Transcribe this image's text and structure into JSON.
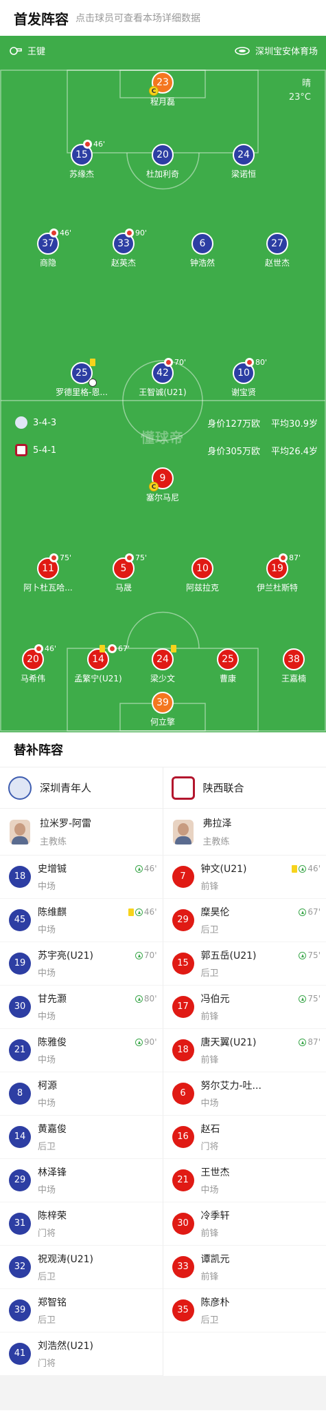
{
  "header": {
    "title": "首发阵容",
    "subtitle": "点击球员可查看本场详细数据"
  },
  "pitch": {
    "referee": "王键",
    "venue": "深圳宝安体育场",
    "weather": {
      "condition": "晴",
      "temperature": "23°C"
    },
    "watermark": "懂球帝"
  },
  "home_team": {
    "name": "深圳青年人",
    "formation": "3-4-3",
    "value": "身价127万欧",
    "avg_age": "平均30.9岁",
    "color": "#2d3ea3",
    "lineup": [
      {
        "number": "23",
        "name": "程月磊",
        "captain_mark": "C"
      },
      {
        "number": "15",
        "name": "苏缘杰",
        "sub_minute": "46'"
      },
      {
        "number": "20",
        "name": "杜加利奇"
      },
      {
        "number": "24",
        "name": "梁诺恒"
      },
      {
        "number": "37",
        "name": "商隐",
        "sub_minute": "46'"
      },
      {
        "number": "33",
        "name": "赵英杰",
        "sub_minute": "90'"
      },
      {
        "number": "6",
        "name": "钟浩然"
      },
      {
        "number": "27",
        "name": "赵世杰"
      },
      {
        "number": "25",
        "name": "罗德里格-恩..."
      },
      {
        "number": "42",
        "name": "王智诚(U21)",
        "sub_minute": "70'"
      },
      {
        "number": "10",
        "name": "谢宝贤",
        "sub_minute": "80'"
      }
    ]
  },
  "away_team": {
    "name": "陕西联合",
    "formation": "5-4-1",
    "value": "身价305万欧",
    "avg_age": "平均26.4岁",
    "color": "#e01a14",
    "lineup": [
      {
        "number": "9",
        "name": "塞尔马尼",
        "captain_mark": "C"
      },
      {
        "number": "11",
        "name": "阿卜杜瓦哈...",
        "sub_minute": "75'"
      },
      {
        "number": "5",
        "name": "马晟",
        "sub_minute": "75'"
      },
      {
        "number": "10",
        "name": "阿兹拉克"
      },
      {
        "number": "19",
        "name": "伊兰杜斯特",
        "sub_minute": "87'"
      },
      {
        "number": "20",
        "name": "马希伟",
        "sub_minute": "46'"
      },
      {
        "number": "14",
        "name": "孟繁宁(U21)",
        "sub_minute": "67'"
      },
      {
        "number": "24",
        "name": "梁少文"
      },
      {
        "number": "25",
        "name": "曹康"
      },
      {
        "number": "38",
        "name": "王嘉楠"
      },
      {
        "number": "39",
        "name": "何立擎"
      }
    ]
  },
  "substitutes": {
    "title": "替补阵容",
    "home": {
      "coach": {
        "name": "拉米罗-阿雷",
        "role": "主教练"
      },
      "players": [
        {
          "number": "18",
          "name": "史增铖",
          "position": "中场",
          "in_minute": "46'"
        },
        {
          "number": "45",
          "name": "陈维麒",
          "position": "中场",
          "in_minute": "46'"
        },
        {
          "number": "19",
          "name": "苏宇亮(U21)",
          "position": "中场",
          "in_minute": "70'"
        },
        {
          "number": "30",
          "name": "甘先灏",
          "position": "中场",
          "in_minute": "80'"
        },
        {
          "number": "21",
          "name": "陈雅俊",
          "position": "中场",
          "in_minute": "90'"
        },
        {
          "number": "8",
          "name": "柯源",
          "position": "中场"
        },
        {
          "number": "14",
          "name": "黄嘉俊",
          "position": "后卫"
        },
        {
          "number": "29",
          "name": "林泽锋",
          "position": "中场"
        },
        {
          "number": "31",
          "name": "陈梓荣",
          "position": "门将"
        },
        {
          "number": "32",
          "name": "祝观涛(U21)",
          "position": "后卫"
        },
        {
          "number": "39",
          "name": "郑智铭",
          "position": "后卫"
        },
        {
          "number": "41",
          "name": "刘浩然(U21)",
          "position": "门将"
        }
      ]
    },
    "away": {
      "coach": {
        "name": "弗拉泽",
        "role": "主教练"
      },
      "players": [
        {
          "number": "7",
          "name": "钟文(U21)",
          "position": "前锋",
          "in_minute": "46'"
        },
        {
          "number": "29",
          "name": "糜昊伦",
          "position": "后卫",
          "in_minute": "67'"
        },
        {
          "number": "15",
          "name": "郭五岳(U21)",
          "position": "后卫",
          "in_minute": "75'"
        },
        {
          "number": "17",
          "name": "冯伯元",
          "position": "前锋",
          "in_minute": "75'"
        },
        {
          "number": "18",
          "name": "唐天翼(U21)",
          "position": "前锋",
          "in_minute": "87'"
        },
        {
          "number": "6",
          "name": "努尔艾力-吐...",
          "position": "中场"
        },
        {
          "number": "16",
          "name": "赵石",
          "position": "门将"
        },
        {
          "number": "21",
          "name": "王世杰",
          "position": "中场"
        },
        {
          "number": "30",
          "name": "冷季轩",
          "position": "前锋"
        },
        {
          "number": "33",
          "name": "谭凯元",
          "position": "前锋"
        },
        {
          "number": "35",
          "name": "陈彦朴",
          "position": "后卫"
        }
      ]
    }
  }
}
